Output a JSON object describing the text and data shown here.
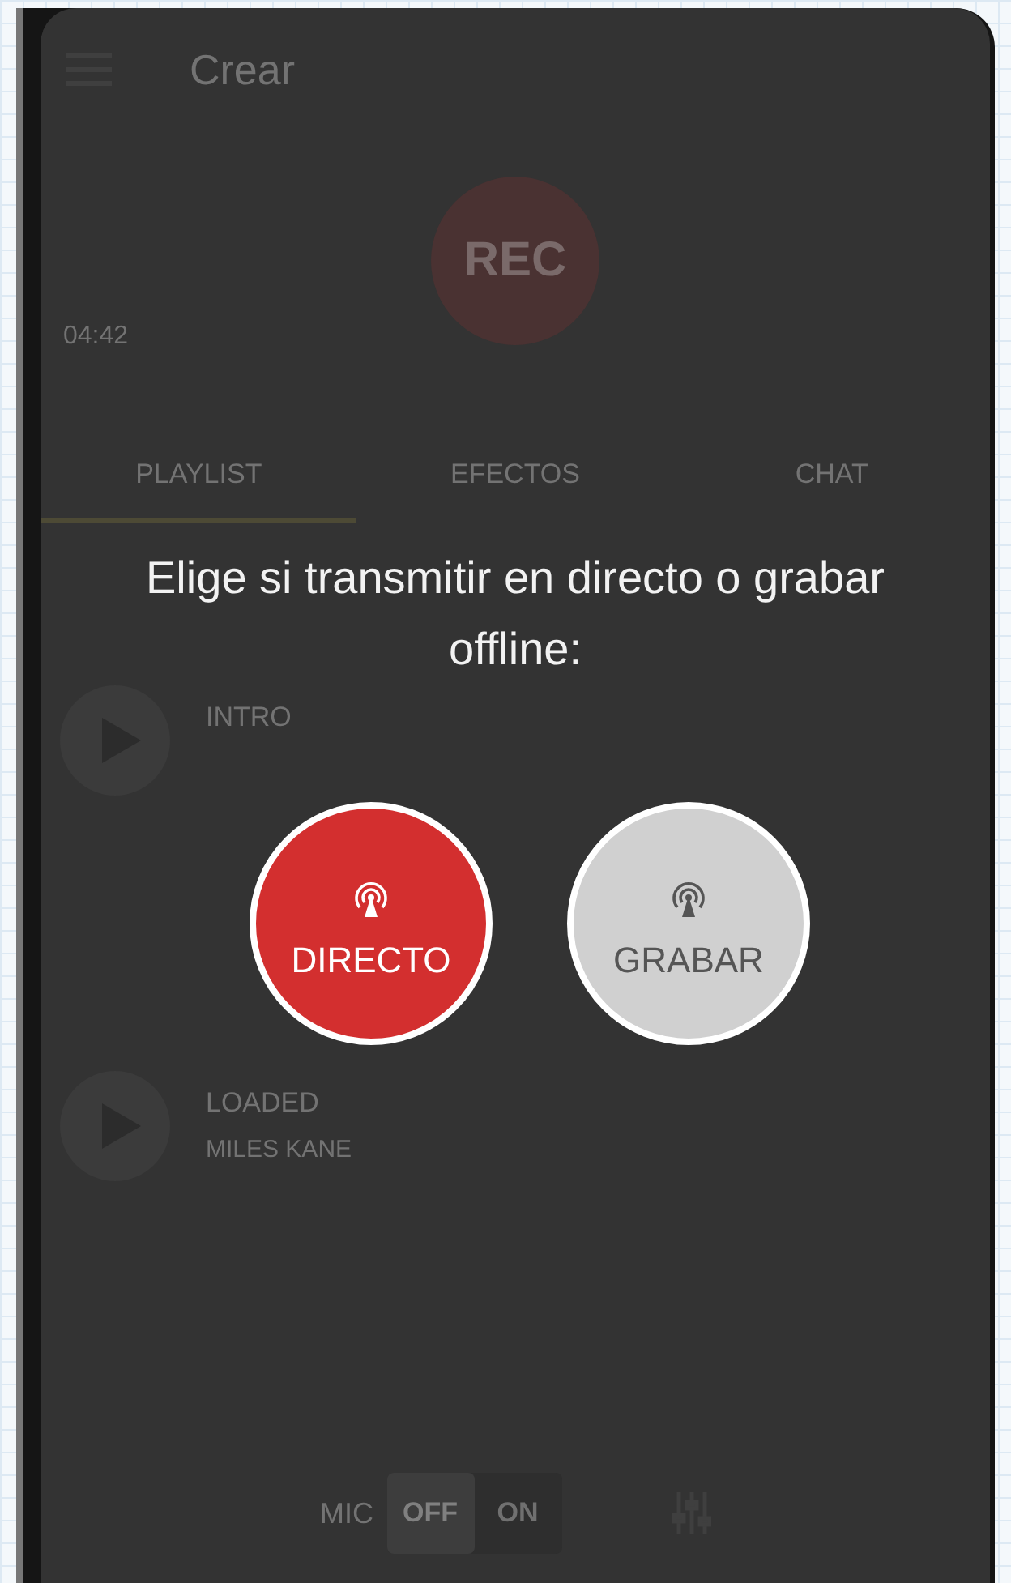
{
  "app_bar": {
    "title": "Crear"
  },
  "recorder": {
    "button": "REC",
    "elapsed": "04:42"
  },
  "tabs": [
    {
      "label": "PLAYLIST",
      "selected": true
    },
    {
      "label": "EFECTOS",
      "selected": false
    },
    {
      "label": "CHAT",
      "selected": false
    }
  ],
  "playlist": [
    {
      "title": "INTRO"
    },
    {
      "title": "LOADED",
      "artist": "MILES KANE"
    }
  ],
  "bottom_bar": {
    "mic_label": "MIC",
    "toggle": [
      {
        "label": "OFF",
        "selected": true
      },
      {
        "label": "ON",
        "selected": false
      }
    ]
  },
  "dialog": {
    "prompt": "Elige si transmitir en directo o grabar offline:",
    "options": [
      {
        "label": "DIRECTO",
        "kind": "live",
        "color": "#d32f2f"
      },
      {
        "label": "GRABAR",
        "kind": "record",
        "color": "#d0d0d0"
      }
    ]
  }
}
